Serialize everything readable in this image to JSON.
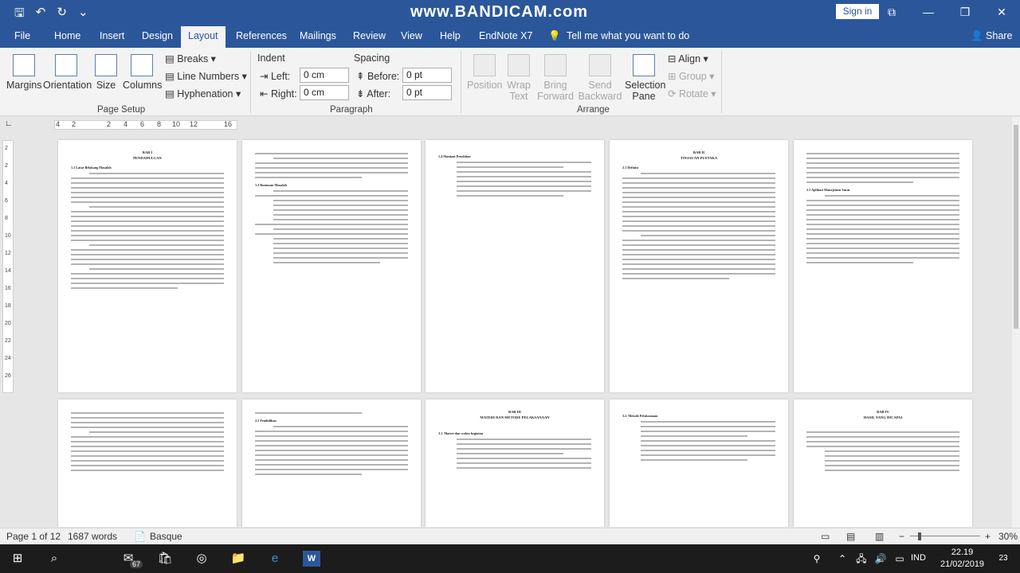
{
  "title_bar": {
    "watermark": "www.BANDICAM.com",
    "sign_in": "Sign in",
    "qat": {
      "save": "🖫",
      "undo": "↶",
      "redo": "↻",
      "customize": "⌄"
    },
    "window": {
      "restore": "⧉",
      "minimize": "—",
      "maximize": "❐",
      "close": "✕"
    }
  },
  "tabs": [
    "File",
    "Home",
    "Insert",
    "Design",
    "Layout",
    "References",
    "Mailings",
    "Review",
    "View",
    "Help",
    "EndNote X7"
  ],
  "active_tab": "Layout",
  "tell_me": "Tell me what you want to do",
  "share": "Share",
  "ribbon": {
    "page_setup": {
      "label": "Page Setup",
      "margins": "Margins",
      "orientation": "Orientation",
      "size": "Size",
      "columns": "Columns",
      "breaks": "Breaks",
      "line_numbers": "Line Numbers",
      "hyphenation": "Hyphenation"
    },
    "paragraph": {
      "label": "Paragraph",
      "indent": "Indent",
      "left_label": "Left:",
      "left_value": "0 cm",
      "right_label": "Right:",
      "right_value": "0 cm",
      "spacing": "Spacing",
      "before_label": "Before:",
      "before_value": "0 pt",
      "after_label": "After:",
      "after_value": "0 pt"
    },
    "arrange": {
      "label": "Arrange",
      "position": "Position",
      "wrap_text_1": "Wrap",
      "wrap_text_2": "Text",
      "bring_forward_1": "Bring",
      "bring_forward_2": "Forward",
      "send_backward_1": "Send",
      "send_backward_2": "Backward",
      "selection_pane_1": "Selection",
      "selection_pane_2": "Pane",
      "align": "Align",
      "group": "Group",
      "rotate": "Rotate"
    }
  },
  "ruler": {
    "numbers": [
      "4",
      "2",
      "2",
      "4",
      "6",
      "8",
      "10",
      "12",
      "16"
    ]
  },
  "vruler": {
    "numbers": [
      "2",
      "2",
      "4",
      "6",
      "8",
      "10",
      "12",
      "14",
      "16",
      "18",
      "20",
      "22",
      "24",
      "26"
    ]
  },
  "pages_row1": [
    {
      "heading": "BAB I",
      "heading2": "PENDAHULUAN",
      "sub": "1.1  Latar Belakang Masalah"
    },
    {
      "heading": "",
      "heading2": "",
      "sub": "1.2  Rumusan Masalah"
    },
    {
      "heading": "",
      "heading2": "",
      "sub": "1.4  Manfaat Penelitian"
    },
    {
      "heading": "BAB II",
      "heading2": "TINJAUAN PUSTAKA",
      "sub": "2.1 Definisi"
    },
    {
      "heading": "",
      "heading2": "",
      "sub": "2.3  Aplikasi Manajemen Surat"
    }
  ],
  "pages_row2": [
    {
      "heading": "",
      "heading2": "",
      "sub": ""
    },
    {
      "heading": "",
      "heading2": "",
      "sub": "2.5  Pendidikan"
    },
    {
      "heading": "BAB III",
      "heading2": "MATERI DAN METODE PELAKSANAAN",
      "sub": "3.1.  Materi dan waktu kegiatan"
    },
    {
      "heading": "",
      "heading2": "",
      "sub": "3.2.  Metode Pelaksanaan"
    },
    {
      "heading": "BAB IV",
      "heading2": "HASIL YANG DICAPAI",
      "sub": ""
    }
  ],
  "status": {
    "page": "Page 1 of 12",
    "words": "1687 words",
    "language": "Basque",
    "zoom": "30%",
    "zoom_minus": "−",
    "zoom_plus": "+"
  },
  "taskbar": {
    "start": "⊞",
    "search": "⌕",
    "mail_badge": "67",
    "time": "22.19",
    "date": "21/02/2019",
    "lang": "IND",
    "notif_count": "23"
  }
}
